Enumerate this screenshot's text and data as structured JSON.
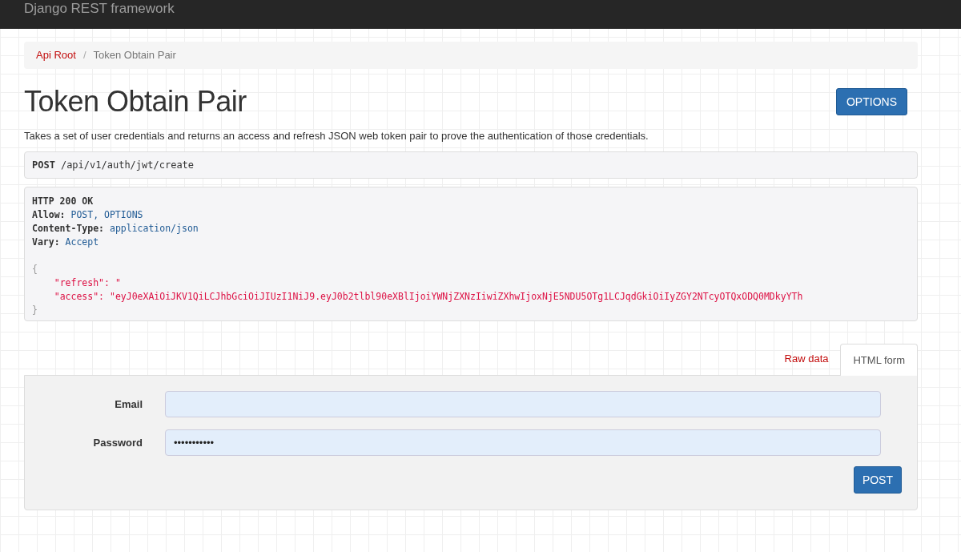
{
  "navbar": {
    "brand": "Django REST framework"
  },
  "breadcrumb_separator": "/",
  "breadcrumbs": [
    {
      "label": "Api Root",
      "kind": "link"
    },
    {
      "label": "Token Obtain Pair",
      "kind": "current"
    }
  ],
  "page": {
    "title": "Token Obtain Pair",
    "options_button": "OPTIONS",
    "description": "Takes a set of user credentials and returns an access and refresh JSON web token pair to prove the authentication of those credentials."
  },
  "request": {
    "method": "POST",
    "path": "/api/v1/auth/jwt/create"
  },
  "response": {
    "status": "HTTP 200 OK",
    "headers": [
      {
        "name": "Allow:",
        "value": "POST, OPTIONS"
      },
      {
        "name": "Content-Type:",
        "value": "application/json"
      },
      {
        "name": "Vary:",
        "value": "Accept"
      }
    ],
    "open_brace": "{",
    "fields": [
      {
        "key": "\"refresh\":",
        "value": "\""
      },
      {
        "key": "\"access\":",
        "value": "\"eyJ0eXAiOiJKV1QiLCJhbGciOiJIUzI1NiJ9.eyJ0b2tlbl90eXBlIjoiYWNjZXNzIiwiZXhwIjoxNjE5NDU5OTg1LCJqdGkiOiIyZGY2NTcyOTQxODQ0MDkyYTh"
      }
    ],
    "close_brace": "}"
  },
  "tabs": [
    {
      "label": "Raw data",
      "selected": false
    },
    {
      "label": "HTML form",
      "selected": true
    }
  ],
  "form": {
    "fields": [
      {
        "label": "Email"
      },
      {
        "label": "Password",
        "value": "•••••••••••"
      }
    ],
    "submit": "POST"
  }
}
